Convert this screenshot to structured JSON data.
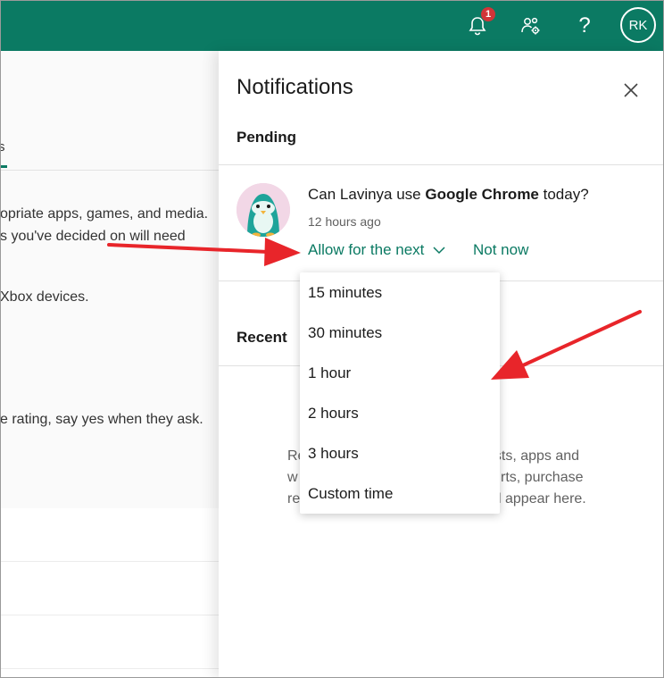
{
  "header": {
    "notification_count": "1",
    "help_label": "?",
    "user_initials": "RK",
    "bar_color": "#0b7a63"
  },
  "background_page": {
    "tab_label": "s",
    "lines": [
      "opriate apps, games, and media.",
      "s you've decided on will need",
      " Xbox devices.",
      "e rating, say yes when they ask."
    ]
  },
  "panel": {
    "title": "Notifications",
    "pending_label": "Pending",
    "request": {
      "prefix": "Can Lavinya use ",
      "app": "Google Chrome",
      "suffix": " today?",
      "time": "12 hours ago",
      "allow_label": "Allow for the next",
      "not_now_label": "Not now"
    },
    "recent_label": "Recent",
    "empty_text": [
      "Re",
      "ests, apps and",
      "w",
      "rts, purchase",
      "re",
      "l appear here."
    ]
  },
  "dropdown": {
    "options": [
      "15 minutes",
      "30 minutes",
      "1 hour",
      "2 hours",
      "3 hours",
      "Custom time"
    ]
  },
  "annotations": {
    "arrow_color": "#e8252a"
  }
}
